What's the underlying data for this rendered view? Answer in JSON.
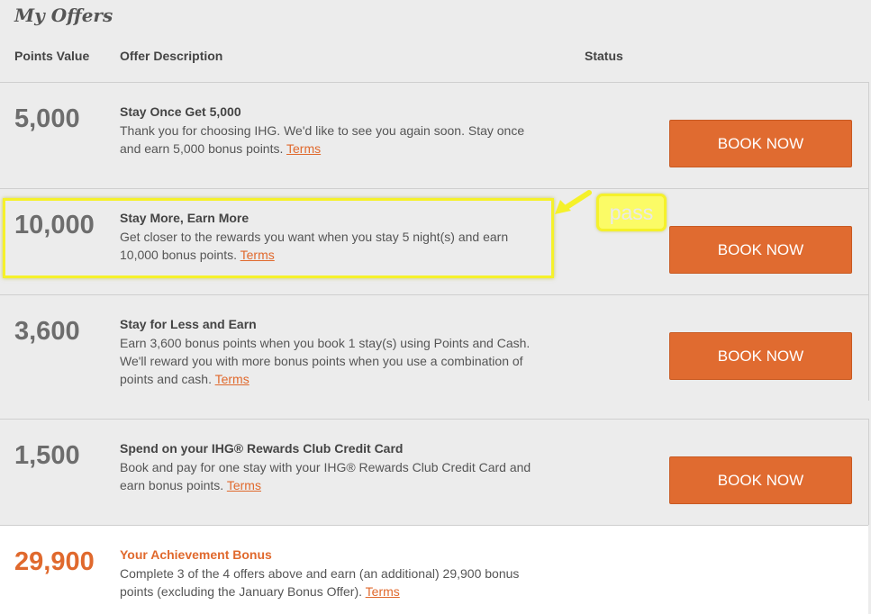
{
  "page": {
    "title": "My Offers"
  },
  "table": {
    "headers": {
      "points": "Points Value",
      "description": "Offer Description",
      "status": "Status"
    }
  },
  "offers": [
    {
      "points": "5,000",
      "title": "Stay Once Get 5,000",
      "body": "Thank you for choosing IHG. We'd like to see you again soon. Stay once and earn 5,000 bonus points.",
      "terms": "Terms",
      "button": "BOOK NOW"
    },
    {
      "points": "10,000",
      "title": "Stay More, Earn More",
      "body": "Get closer to the rewards you want when you stay 5 night(s) and earn 10,000 bonus points.",
      "terms": "Terms",
      "button": "BOOK NOW"
    },
    {
      "points": "3,600",
      "title": "Stay for Less and Earn",
      "body": "Earn 3,600 bonus points when you book 1 stay(s) using Points and Cash. We'll reward you with more bonus points when you use a combination of points and cash.",
      "terms": "Terms",
      "button": "BOOK NOW"
    },
    {
      "points": "1,500",
      "title": "Spend on your IHG® Rewards Club Credit Card",
      "body": "Book and pay for one stay with your IHG® Rewards Club Credit Card and earn bonus points.",
      "terms": "Terms",
      "button": "BOOK NOW"
    }
  ],
  "bonus": {
    "points": "29,900",
    "title": "Your Achievement Bonus",
    "body": "Complete 3 of the 4 offers above and earn (an additional) 29,900 bonus points (excluding the January Bonus Offer).",
    "terms": "Terms"
  },
  "annotation": {
    "label": "pass",
    "color": "#f5f12a"
  },
  "colors": {
    "accent": "#e06b30",
    "background": "#ececec"
  }
}
